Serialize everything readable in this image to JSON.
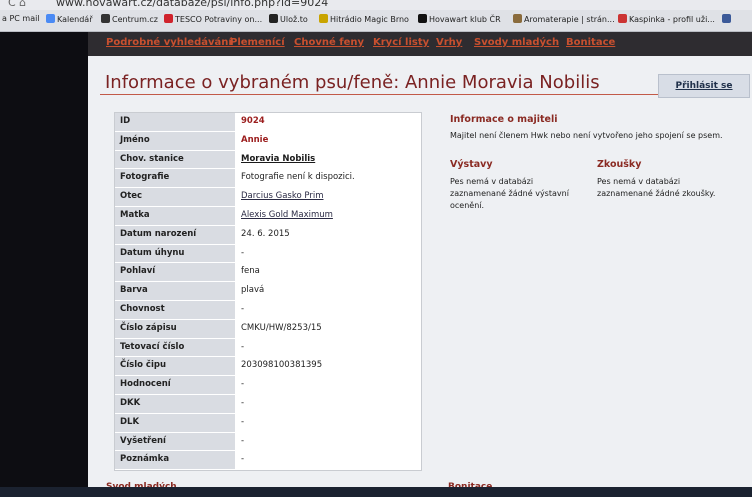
{
  "browser": {
    "url": "www.hovawart.cz/databaze/psi/info.php?id=9024",
    "bookmarks": [
      "a PC mail",
      "Kalendář",
      "Centrum.cz",
      "TESCO Potraviny on...",
      "Ulož.to",
      "Hitrádio Magic Brno",
      "Hovawart klub ČR",
      "Aromaterapie | strán...",
      "Kaspinka - profil uži..."
    ]
  },
  "nav": [
    "Podrobné vyhledávání",
    "Plemenící",
    "Chovné feny",
    "Krycí listy",
    "Vrhy",
    "Svody mladých",
    "Bonitace"
  ],
  "title": "Informace o vybraném psu/feně: Annie Moravia Nobilis",
  "login": "Přihlásit se",
  "details": [
    {
      "label": "ID",
      "value": "9024"
    },
    {
      "label": "Jméno",
      "value": "Annie"
    },
    {
      "label": "Chov. stanice",
      "value": "Moravia Nobilis"
    },
    {
      "label": "Fotografie",
      "value": "Fotografie není k dispozici."
    },
    {
      "label": "Otec",
      "value": "Darcius Gasko Prim"
    },
    {
      "label": "Matka",
      "value": "Alexis Gold Maximum"
    },
    {
      "label": "Datum narození",
      "value": "24. 6. 2015"
    },
    {
      "label": "Datum úhynu",
      "value": "-"
    },
    {
      "label": "Pohlaví",
      "value": "fena"
    },
    {
      "label": "Barva",
      "value": "plavá"
    },
    {
      "label": "Chovnost",
      "value": "-"
    },
    {
      "label": "Číslo zápisu",
      "value": "CMKU/HW/8253/15"
    },
    {
      "label": "Tetovací číslo",
      "value": "-"
    },
    {
      "label": "Číslo čipu",
      "value": "203098100381395"
    },
    {
      "label": "Hodnocení",
      "value": "-"
    },
    {
      "label": "DKK",
      "value": "-"
    },
    {
      "label": "DLK",
      "value": "-"
    },
    {
      "label": "Vyšetření",
      "value": "-"
    },
    {
      "label": "Poznámka",
      "value": "-"
    }
  ],
  "owner": {
    "heading": "Informace o majiteli",
    "text": "Majitel není členem Hwk nebo není vytvořeno jeho spojení se psem."
  },
  "shows": {
    "heading": "Výstavy",
    "text": "Pes nemá v databázi zaznamenané žádné výstavní ocenění."
  },
  "exams": {
    "heading": "Zkoušky",
    "text": "Pes nemá v databázi zaznamenané žádné zkoušky."
  },
  "bottom": {
    "left": "Svod mladých",
    "right": "Bonitace"
  }
}
